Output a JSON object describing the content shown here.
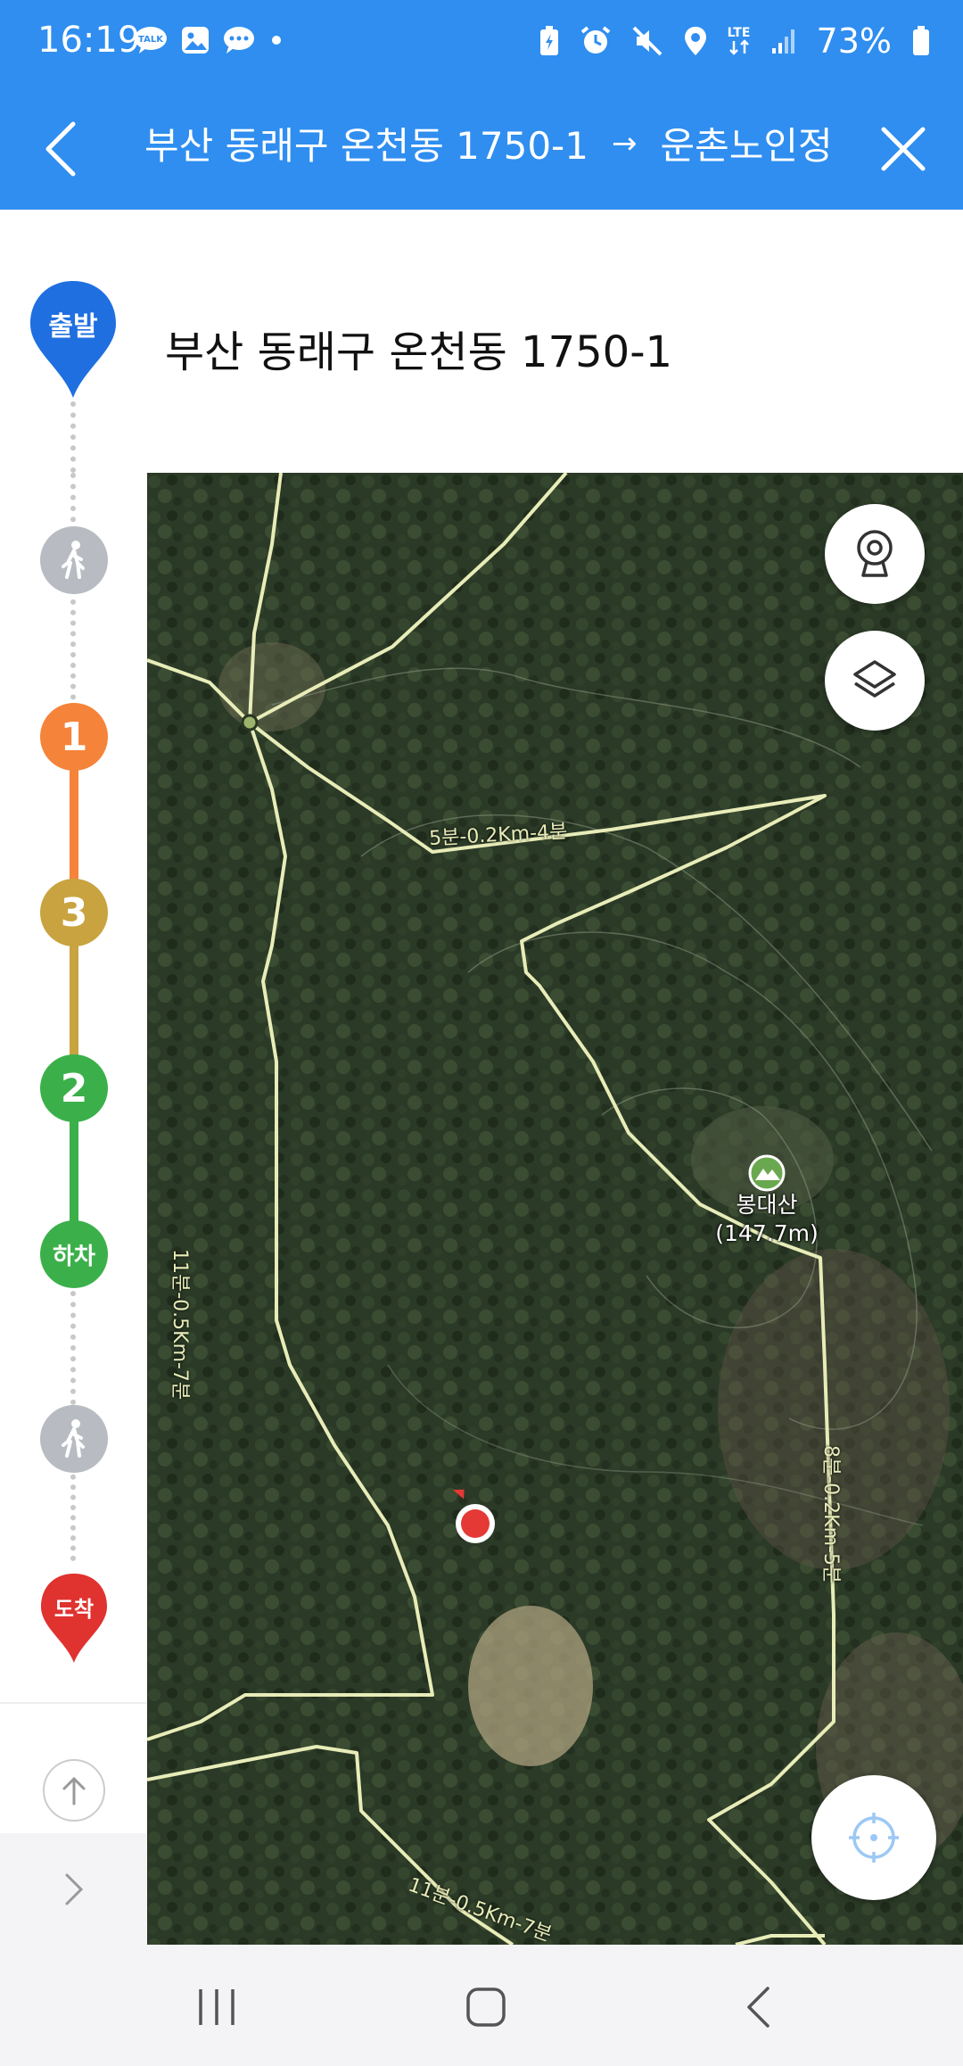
{
  "status_bar": {
    "time": "16:19",
    "network": "LTE",
    "battery": "73%",
    "icons_left": [
      "talk-icon",
      "gallery-icon",
      "message-icon",
      "dot-icon"
    ],
    "icons_right": [
      "battery-saver-icon",
      "alarm-icon",
      "mute-icon",
      "location-icon",
      "lte-icon",
      "signal-icon",
      "battery-icon"
    ]
  },
  "header": {
    "origin": "부산 동래구 온천동 1750-1",
    "arrow": "→",
    "destination": "운촌노인정"
  },
  "origin_panel": {
    "pin_label": "출발",
    "address": "부산 동래구 온천동 1750-1"
  },
  "route_steps": [
    {
      "type": "walk",
      "icon": "walk-icon"
    },
    {
      "type": "line",
      "label": "1",
      "color": "#f5833a"
    },
    {
      "type": "line",
      "label": "3",
      "color": "#c9a33f"
    },
    {
      "type": "line",
      "label": "2",
      "color": "#3bb04a"
    },
    {
      "type": "alight",
      "label": "하차",
      "color": "#3bb04a"
    },
    {
      "type": "walk",
      "icon": "walk-icon"
    },
    {
      "type": "arrive",
      "label": "도착",
      "color": "#e0322f"
    }
  ],
  "map": {
    "peak_name": "봉대산",
    "peak_height": "(147.7m)",
    "trail_labels": [
      "5분-0.2Km-4분",
      "11분-0.5Km-7분",
      "8분-0.2Km-5분",
      "11분-0.5Km-7분"
    ]
  },
  "colors": {
    "header_blue": "#2f8ef0",
    "trail": "#e8ecb8",
    "current_location": "#e53935"
  }
}
